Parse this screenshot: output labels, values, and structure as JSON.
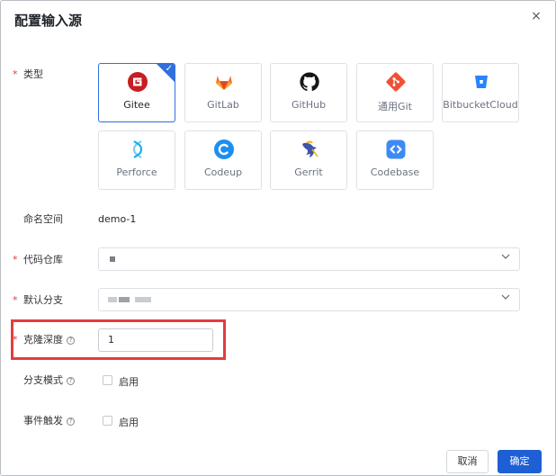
{
  "dialog": {
    "title": "配置输入源",
    "close_glyph": "×"
  },
  "form": {
    "required_mark": "*",
    "help_glyph": "?",
    "type_label": "类型",
    "sources": [
      {
        "name": "Gitee",
        "icon": "gitee-icon",
        "color": "#c71d23",
        "selected": true
      },
      {
        "name": "GitLab",
        "icon": "gitlab-icon",
        "color": "#e2432a"
      },
      {
        "name": "GitHub",
        "icon": "github-icon",
        "color": "#161614"
      },
      {
        "name": "通用Git",
        "icon": "git-icon",
        "color": "#f05133"
      },
      {
        "name": "BitbucketCloud",
        "icon": "bitbucket-icon",
        "color": "#2684ff"
      },
      {
        "name": "Perforce",
        "icon": "perforce-icon",
        "color": "#1ab1e6"
      },
      {
        "name": "Codeup",
        "icon": "codeup-icon",
        "color": "#1b8ff2"
      },
      {
        "name": "Gerrit",
        "icon": "gerrit-icon",
        "color": "#3d56a8"
      },
      {
        "name": "Codebase",
        "icon": "codebase-icon",
        "color": "#3c8bf5"
      }
    ],
    "namespace_label": "命名空间",
    "namespace_value": "demo-1",
    "repo_label": "代码仓库",
    "branch_label": "默认分支",
    "clone_depth_label": "克隆深度",
    "clone_depth_value": "1",
    "branch_mode_label": "分支模式",
    "branch_mode_option": "启用",
    "event_trigger_label": "事件触发",
    "event_trigger_option": "启用"
  },
  "footer": {
    "cancel_label": "取消",
    "ok_label": "确定"
  },
  "colors": {
    "primary": "#1f5fd6",
    "highlight": "#e43d3d",
    "required": "#e53935"
  }
}
